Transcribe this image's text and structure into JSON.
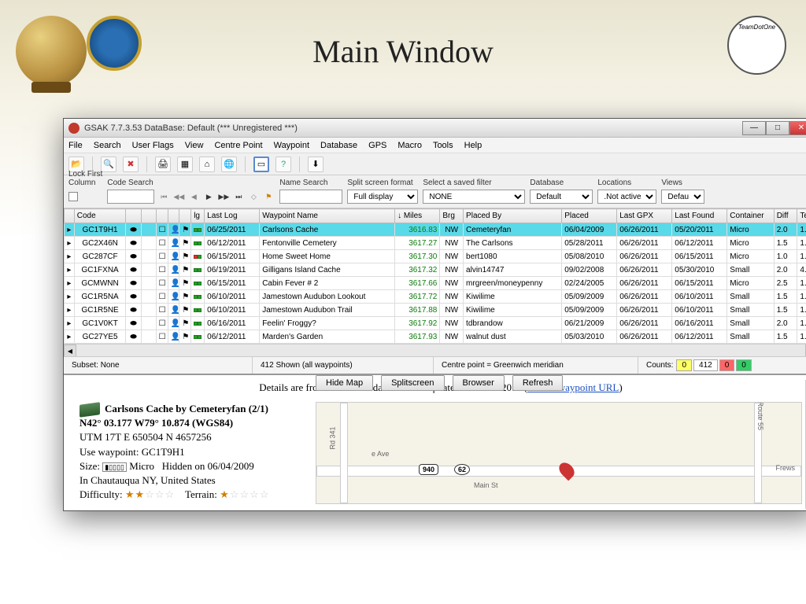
{
  "slide": {
    "title": "Main Window",
    "badge_right": "TeamDotOne"
  },
  "titlebar": {
    "text": "GSAK 7.7.3.53   DataBase: Default  (*** Unregistered ***)"
  },
  "menu": [
    "File",
    "Search",
    "User Flags",
    "View",
    "Centre Point",
    "Waypoint",
    "Database",
    "GPS",
    "Macro",
    "Tools",
    "Help"
  ],
  "toolbar2": {
    "lock_first_label": "Lock First\nColumn",
    "code_search_label": "Code Search",
    "name_search_label": "Name Search",
    "split_label": "Split screen format",
    "split_value": "Full display",
    "filter_label": "Select a saved filter",
    "filter_value": "NONE",
    "database_label": "Database",
    "database_value": "Default",
    "locations_label": "Locations",
    "locations_value": ".Not active",
    "views_label": "Views",
    "views_value": "Default"
  },
  "columns": [
    "",
    "Code",
    "",
    "",
    "",
    "",
    "",
    "lg",
    "Last Log",
    "Waypoint Name",
    "↓ Miles",
    "Brg",
    "Placed By",
    "Placed",
    "Last GPX",
    "Last Found",
    "Container",
    "Diff",
    "Ter"
  ],
  "rows": [
    {
      "code": "GC1T9H1",
      "lastlog": "06/25/2011",
      "name": "Carlsons Cache",
      "miles": "3616.83",
      "brg": "NW",
      "by": "Cemeteryfan",
      "placed": "06/04/2009",
      "gpx": "06/26/2011",
      "found": "05/20/2011",
      "cont": "Micro",
      "diff": "2.0",
      "ter": "1.",
      "sel": true,
      "sq": "gg"
    },
    {
      "code": "GC2X46N",
      "lastlog": "06/12/2011",
      "name": "Fentonville Cemetery",
      "miles": "3617.27",
      "brg": "NW",
      "by": "The Carlsons",
      "placed": "05/28/2011",
      "gpx": "06/26/2011",
      "found": "06/12/2011",
      "cont": "Micro",
      "diff": "1.5",
      "ter": "1.",
      "sq": "gg"
    },
    {
      "code": "GC287CF",
      "lastlog": "06/15/2011",
      "name": "Home Sweet Home",
      "miles": "3617.30",
      "brg": "NW",
      "by": "bert1080",
      "placed": "05/08/2010",
      "gpx": "06/26/2011",
      "found": "06/15/2011",
      "cont": "Micro",
      "diff": "1.0",
      "ter": "1.",
      "sq": "rg"
    },
    {
      "code": "GC1FXNA",
      "lastlog": "06/19/2011",
      "name": "Gilligans Island Cache",
      "miles": "3617.32",
      "brg": "NW",
      "by": "alvin14747",
      "placed": "09/02/2008",
      "gpx": "06/26/2011",
      "found": "05/30/2010",
      "cont": "Small",
      "diff": "2.0",
      "ter": "4.",
      "sq": "gg"
    },
    {
      "code": "GCMWNN",
      "lastlog": "06/15/2011",
      "name": "Cabin Fever #  2",
      "miles": "3617.66",
      "brg": "NW",
      "by": "mrgreen/moneypenny",
      "placed": "02/24/2005",
      "gpx": "06/26/2011",
      "found": "06/15/2011",
      "cont": "Micro",
      "diff": "2.5",
      "ter": "1.",
      "sq": "gg"
    },
    {
      "code": "GC1R5NA",
      "lastlog": "06/10/2011",
      "name": "Jamestown Audubon Lookout",
      "miles": "3617.72",
      "brg": "NW",
      "by": "Kiwilime",
      "placed": "05/09/2009",
      "gpx": "06/26/2011",
      "found": "06/10/2011",
      "cont": "Small",
      "diff": "1.5",
      "ter": "1.",
      "sq": "gg"
    },
    {
      "code": "GC1R5NE",
      "lastlog": "06/10/2011",
      "name": "Jamestown Audubon Trail",
      "miles": "3617.88",
      "brg": "NW",
      "by": "Kiwilime",
      "placed": "05/09/2009",
      "gpx": "06/26/2011",
      "found": "06/10/2011",
      "cont": "Small",
      "diff": "1.5",
      "ter": "1.",
      "sq": "gg"
    },
    {
      "code": "GC1V0KT",
      "lastlog": "06/16/2011",
      "name": "Feelin' Froggy?",
      "miles": "3617.92",
      "brg": "NW",
      "by": "tdbrandow",
      "placed": "06/21/2009",
      "gpx": "06/26/2011",
      "found": "06/16/2011",
      "cont": "Small",
      "diff": "2.0",
      "ter": "1.",
      "sq": "gg"
    },
    {
      "code": "GC27YE5",
      "lastlog": "06/12/2011",
      "name": "Marden's Garden",
      "miles": "3617.93",
      "brg": "NW",
      "by": "walnut dust",
      "placed": "05/03/2010",
      "gpx": "06/26/2011",
      "found": "06/12/2011",
      "cont": "Small",
      "diff": "1.5",
      "ter": "1.",
      "sq": "gg"
    }
  ],
  "status": {
    "subset": "Subset: None",
    "shown": "412 Shown (all waypoints)",
    "centre": "Centre point = Greenwich meridian",
    "counts_label": "Counts:",
    "counts": [
      {
        "v": "0",
        "bg": "#ffff66"
      },
      {
        "v": "412",
        "bg": "#fff"
      },
      {
        "v": "0",
        "bg": "#ff6666"
      },
      {
        "v": "0",
        "bg": "#33cc66"
      }
    ]
  },
  "detail": {
    "header_text": "Details are from the offline database last updated on 06/26/2011 (",
    "header_link": "Online waypoint URL",
    "header_suffix": ")",
    "buttons": [
      "Hide Map",
      "Splitscreen",
      "Browser",
      "Refresh"
    ],
    "title": "Carlsons Cache by Cemeteryfan (2/1)",
    "coord": "N42° 03.177  W79° 10.874 (WGS84)",
    "utm": "UTM  17T   E 650504  N 4657256",
    "waypoint": "Use waypoint: GC1T9H1",
    "size_label": "Size:",
    "size_value": "Micro",
    "hidden": "Hidden on 06/04/2009",
    "location": "In Chautauqua NY, United States",
    "diff_label": "Difficulty:",
    "terr_label": "Terrain:",
    "map_labels": {
      "rd341": "Rd 341",
      "eave": "e Ave",
      "mainst": "Main St",
      "frews": "Frews",
      "route55": "g Route 55",
      "s940": "940",
      "s62": "62"
    }
  }
}
